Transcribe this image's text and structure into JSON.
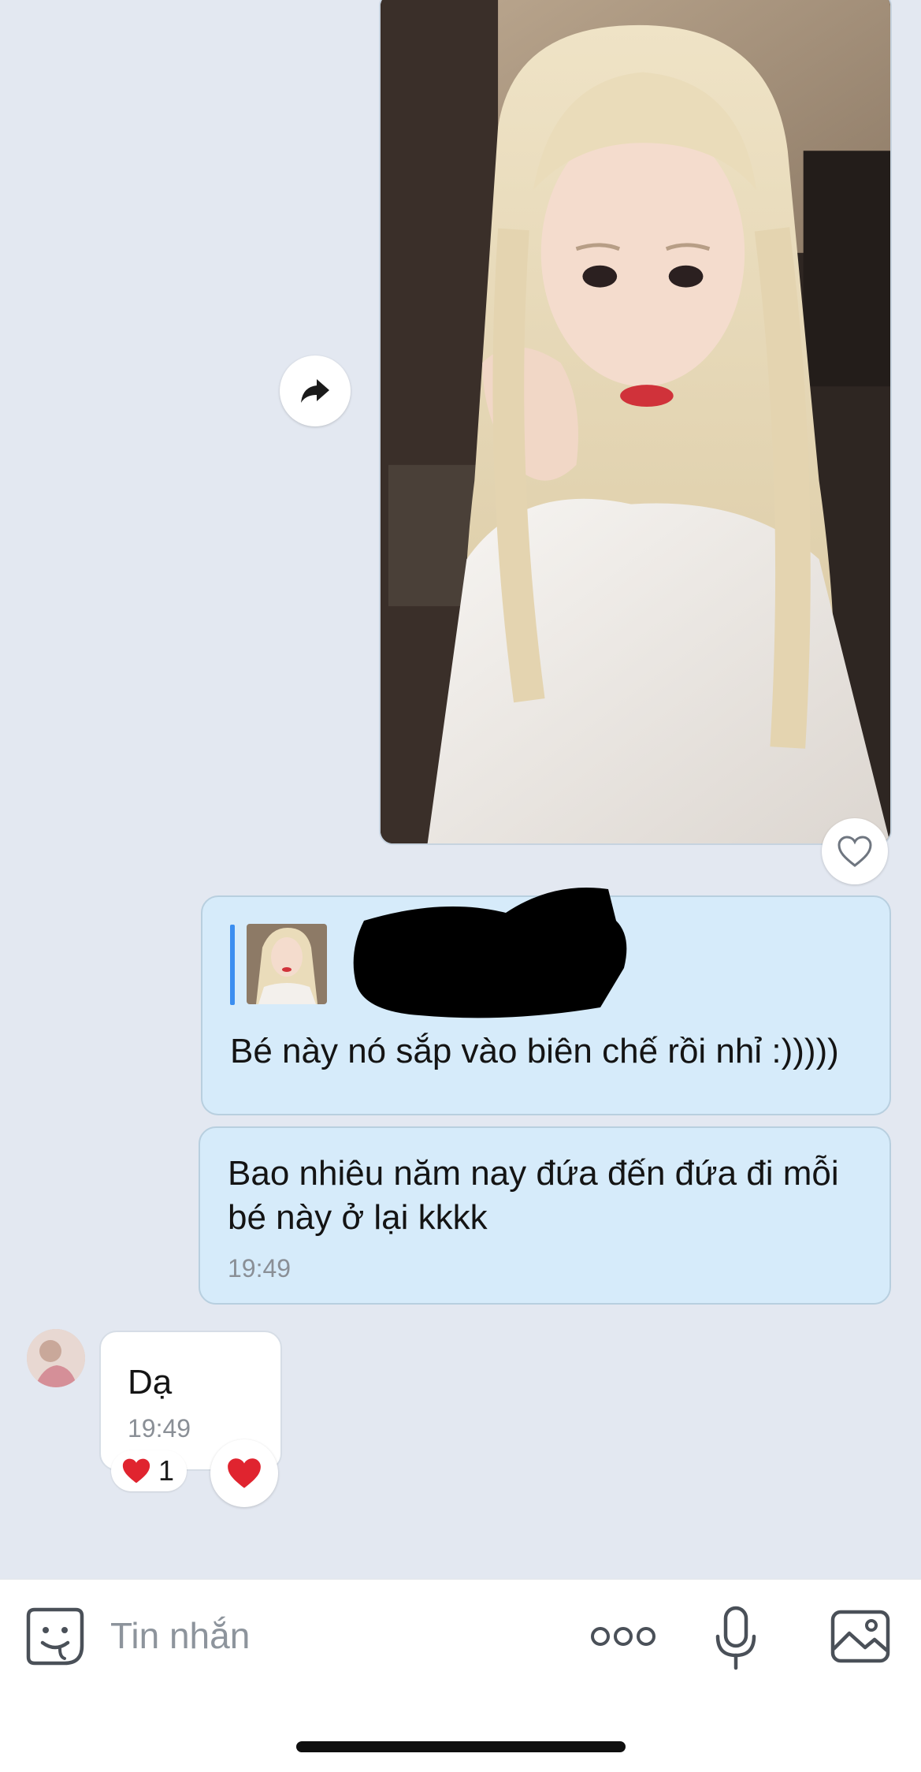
{
  "messages": {
    "reply": {
      "text": "Bé này nó sắp vào biên chế rồi nhỉ :)))))"
    },
    "sent_text": {
      "text": "Bao nhiêu năm nay đứa đến đứa đi mỗi bé này ở lại kkkk",
      "time": "19:49"
    },
    "received": {
      "text": "Dạ",
      "time": "19:49",
      "reaction_count": "1"
    }
  },
  "input": {
    "placeholder": "Tin nhắn"
  },
  "icons": {
    "forward": "forward-arrow-icon",
    "like": "heart-outline-icon",
    "reaction": "red-heart-icon",
    "emoji": "sticker-icon",
    "more": "more-dots-icon",
    "mic": "microphone-icon",
    "gallery": "image-gallery-icon"
  },
  "colors": {
    "sent_bubble": "#d6ebfa",
    "received_bubble": "#ffffff",
    "chat_background": "#e3e8f1",
    "quote_bar": "#3b8ef0",
    "heart": "#e0242f"
  }
}
